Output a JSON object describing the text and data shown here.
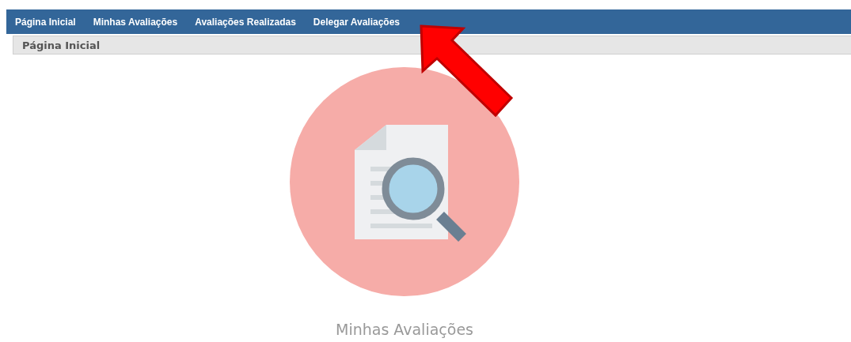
{
  "menu": [
    {
      "label": "Página Inicial"
    },
    {
      "label": "Minhas Avaliações"
    },
    {
      "label": "Avaliações Realizadas"
    },
    {
      "label": "Delegar Avaliações"
    }
  ],
  "breadcrumb": "Página Inicial",
  "tile": {
    "caption": "Minhas Avaliações"
  }
}
